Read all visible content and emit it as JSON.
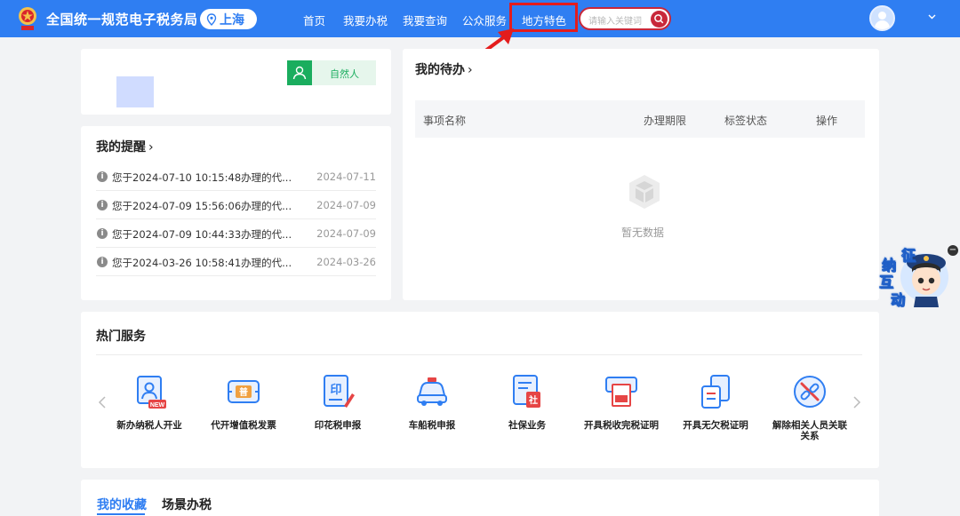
{
  "header": {
    "site_title": "全国统一规范电子税务局",
    "city": "上海",
    "nav": [
      "首页",
      "我要办税",
      "我要查询",
      "公众服务",
      "地方特色"
    ],
    "search_placeholder": "请输入关键词"
  },
  "profile": {
    "user_type": "自然人"
  },
  "reminders": {
    "title": "我的提醒",
    "items": [
      {
        "text": "您于2024-07-10 10:15:48办理的代...",
        "date": "2024-07-11"
      },
      {
        "text": "您于2024-07-09 15:56:06办理的代...",
        "date": "2024-07-09"
      },
      {
        "text": "您于2024-07-09 10:44:33办理的代...",
        "date": "2024-07-09"
      },
      {
        "text": "您于2024-03-26 10:58:41办理的代...",
        "date": "2024-03-26"
      }
    ]
  },
  "todo": {
    "title": "我的待办",
    "columns": [
      "事项名称",
      "办理期限",
      "标签状态",
      "操作"
    ],
    "empty_text": "暂无数据"
  },
  "hot_services": {
    "title": "热门服务",
    "items": [
      {
        "label": "新办纳税人开业",
        "icon": "new-taxpayer-icon"
      },
      {
        "label": "代开增值税发票",
        "icon": "vat-invoice-icon"
      },
      {
        "label": "印花税申报",
        "icon": "stamp-tax-icon"
      },
      {
        "label": "车船税申报",
        "icon": "vehicle-tax-icon"
      },
      {
        "label": "社保业务",
        "icon": "social-security-icon"
      },
      {
        "label": "开具税收完税证明",
        "icon": "tax-payment-certificate-icon"
      },
      {
        "label": "开具无欠税证明",
        "icon": "no-arrears-certificate-icon"
      },
      {
        "label": "解除相关人员关联关系",
        "icon": "unlink-relation-icon"
      }
    ]
  },
  "favorites": {
    "tabs": [
      "我的收藏",
      "场景办税"
    ]
  },
  "helper": {
    "chars": [
      "征",
      "纳",
      "互",
      "动"
    ]
  },
  "colors": {
    "primary": "#2f7ef2",
    "highlight": "#e41c1c",
    "success": "#1aad5e"
  }
}
